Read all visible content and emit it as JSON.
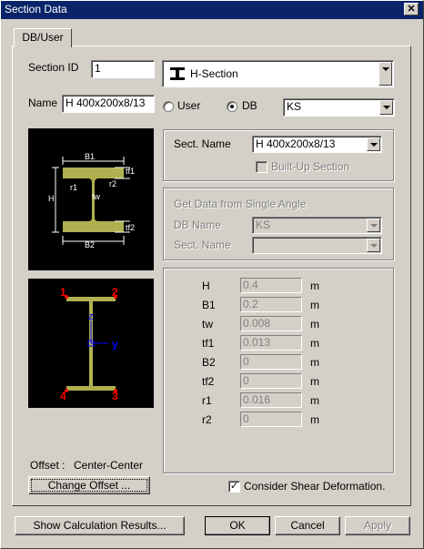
{
  "window": {
    "title": "Section Data",
    "close_glyph": "✕"
  },
  "tab": {
    "label": "DB/User"
  },
  "section_id": {
    "label": "Section ID",
    "value": "1"
  },
  "section_type": {
    "value": "H-Section",
    "icon": "h-section-icon"
  },
  "name": {
    "label": "Name",
    "value": "H 400x200x8/13"
  },
  "source": {
    "user_label": "User",
    "db_label": "DB",
    "selected": "DB",
    "db_value": "KS"
  },
  "diagram": {
    "labels": {
      "b1": "B1",
      "b2": "B2",
      "h": "H",
      "tf1": "tf1",
      "tf2": "tf2",
      "tw": "tw",
      "r1": "r1",
      "r2": "r2"
    }
  },
  "offset_diagram": {
    "points": [
      "1",
      "2",
      "3",
      "4"
    ],
    "z": "z",
    "y": "y"
  },
  "sect_name": {
    "label": "Sect. Name",
    "value": "H 400x200x8/13",
    "builtup_label": "Built-Up Section"
  },
  "single_angle": {
    "title": "Get Data from Single Angle",
    "db_label": "DB Name",
    "db_value": "KS",
    "sect_label": "Sect. Name",
    "sect_value": ""
  },
  "properties": [
    {
      "name": "H",
      "value": "0.4",
      "unit": "m"
    },
    {
      "name": "B1",
      "value": "0.2",
      "unit": "m"
    },
    {
      "name": "tw",
      "value": "0.008",
      "unit": "m"
    },
    {
      "name": "tf1",
      "value": "0.013",
      "unit": "m"
    },
    {
      "name": "B2",
      "value": "0",
      "unit": "m"
    },
    {
      "name": "tf2",
      "value": "0",
      "unit": "m"
    },
    {
      "name": "r1",
      "value": "0.016",
      "unit": "m"
    },
    {
      "name": "r2",
      "value": "0",
      "unit": "m"
    }
  ],
  "offset": {
    "label": "Offset :",
    "value": "Center-Center",
    "change_button": "Change Offset ..."
  },
  "shear": {
    "label": "Consider Shear Deformation.",
    "checked": true
  },
  "buttons": {
    "show_calc": "Show Calculation Results...",
    "ok": "OK",
    "cancel": "Cancel",
    "apply": "Apply"
  },
  "colors": {
    "section_fill": "#b0b050",
    "point_label": "#ff0000",
    "axis": "#0000ff",
    "titlebar": "#0a246a"
  }
}
